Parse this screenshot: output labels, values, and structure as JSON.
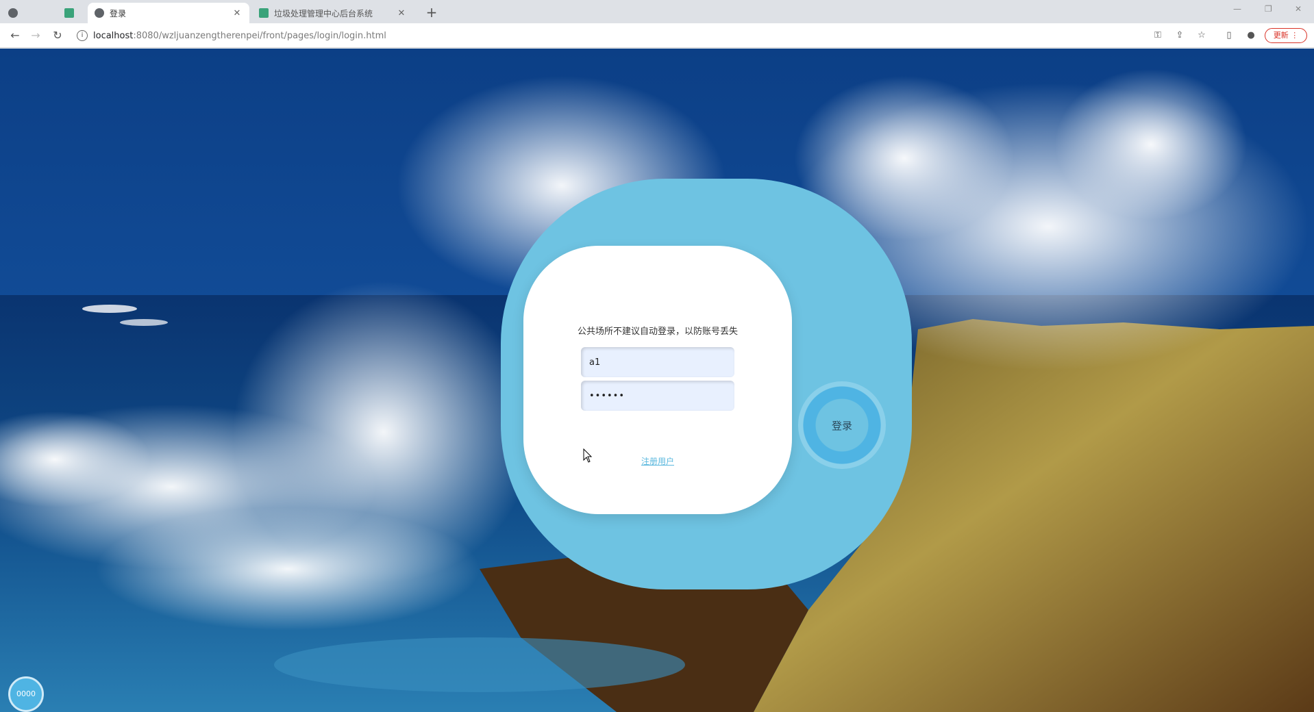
{
  "browser": {
    "tabs": [
      {
        "title": "",
        "icon": "globe-icon"
      },
      {
        "title": "",
        "icon": "vue-icon"
      },
      {
        "title": "登录",
        "icon": "globe-icon"
      },
      {
        "title": "垃圾处理管理中心后台系统",
        "icon": "vue-icon"
      }
    ],
    "url_host": "localhost",
    "url_path": ":8080/wzljuanzengtherenpei/front/pages/login/login.html",
    "update_label": "更新"
  },
  "login": {
    "notice": "公共场所不建议自动登录，以防账号丢失",
    "username_value": "a1",
    "password_value": "••••••",
    "login_label": "登录",
    "register_label": "注册用户"
  },
  "float_button": {
    "label": "0000"
  },
  "colors": {
    "blob": "#6ec3e2",
    "accent": "#4fb4e3",
    "card": "#ffffff",
    "update_red": "#d93025"
  }
}
